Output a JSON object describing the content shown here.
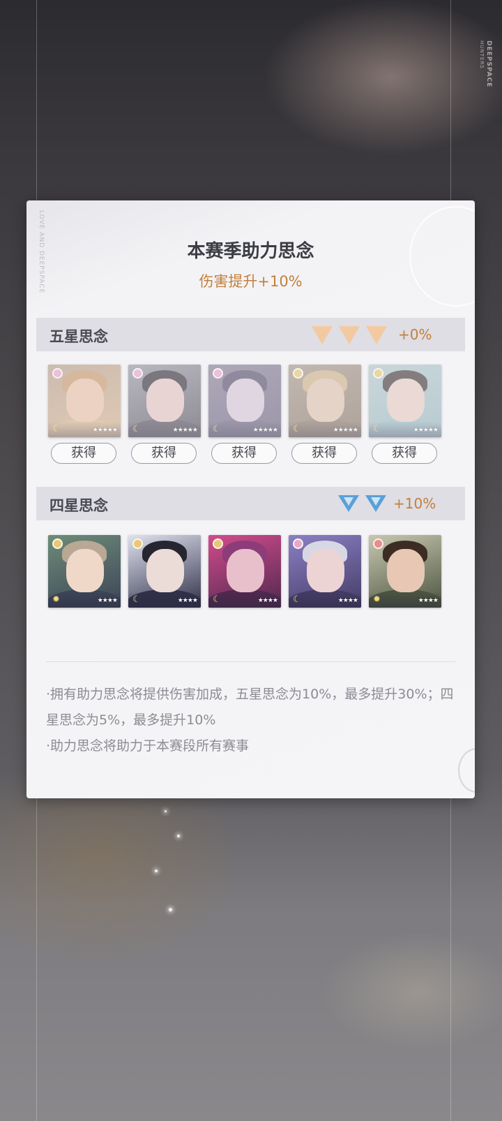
{
  "background": {
    "brand_main": "DEEPSPACE",
    "brand_sub": "HUNTERS"
  },
  "dialog": {
    "side_text": "LOVE AND DEEPSPACE",
    "title": "本赛季助力思念",
    "subtitle": "伤害提升+10%",
    "five_star": {
      "title": "五星思念",
      "bonus": "+0%",
      "indicator_icons": [
        "triangle-gold-icon",
        "triangle-gold-icon",
        "triangle-gold-icon"
      ],
      "cards": [
        {
          "badge_color": "#e8a8c8",
          "skin": "#e8c2a8",
          "hair": "#c89a6c",
          "body": "#d6b48e",
          "bg": "#b8a08c",
          "stars": "★★★★★",
          "icon": "moon-icon"
        },
        {
          "badge_color": "#e8a8c8",
          "skin": "#e3c7c0",
          "hair": "#3c3640",
          "body": "#5a5460",
          "bg": "#9a9aa4",
          "stars": "★★★★★",
          "icon": "moon-icon"
        },
        {
          "badge_color": "#e8a8c8",
          "skin": "#d7c8d8",
          "hair": "#5c5470",
          "body": "#6e6680",
          "bg": "#8a8298",
          "stars": "★★★★★",
          "icon": "moon-icon"
        },
        {
          "badge_color": "#e8c874",
          "skin": "#e0c4b0",
          "hair": "#cfb28c",
          "body": "#8c7a6a",
          "bg": "#a89a8c",
          "stars": "★★★★★",
          "icon": "moon-icon"
        },
        {
          "badge_color": "#e8c874",
          "skin": "#e6ccc4",
          "hair": "#4a4040",
          "body": "#9ab8c0",
          "bg": "#b4c8c8",
          "stars": "★★★★★",
          "icon": "moon-icon"
        }
      ],
      "button_label": "获得"
    },
    "four_star": {
      "title": "四星思念",
      "bonus": "+10%",
      "indicator_icons": [
        "triangle-blue-icon",
        "triangle-blue-icon"
      ],
      "cards": [
        {
          "badge_color": "#e8c874",
          "skin": "#f0d8c8",
          "hair": "#b8a894",
          "body": "#3c4458",
          "bg": "#6e8c78",
          "stars": "★★★★",
          "icon": "sun-icon"
        },
        {
          "badge_color": "#e8c874",
          "skin": "#ecdcd8",
          "hair": "#262630",
          "body": "#30304a",
          "bg": "#dfe2ee",
          "stars": "★★★★",
          "icon": "moon-icon"
        },
        {
          "badge_color": "#e8c874",
          "skin": "#e8c0cc",
          "hair": "#8c3c78",
          "body": "#502850",
          "bg": "#d24c8c",
          "stars": "★★★★",
          "icon": "moon-icon"
        },
        {
          "badge_color": "#e8a8c8",
          "skin": "#ecd4d4",
          "hair": "#d8d8e4",
          "body": "#443c66",
          "bg": "#8c80c4",
          "stars": "★★★★",
          "icon": "moon-icon"
        },
        {
          "badge_color": "#e88c8c",
          "skin": "#e8c8b4",
          "hair": "#3c2c24",
          "body": "#4c5440",
          "bg": "#c8c8b0",
          "stars": "★★★★",
          "icon": "sun-icon"
        }
      ]
    },
    "notes": [
      "·拥有助力思念将提供伤害加成，五星思念为10%，最多提升30%；四星思念为5%，最多提升10%",
      "·助力思念将助力于本赛段所有赛事"
    ],
    "accent_color": "#c47f3a"
  }
}
